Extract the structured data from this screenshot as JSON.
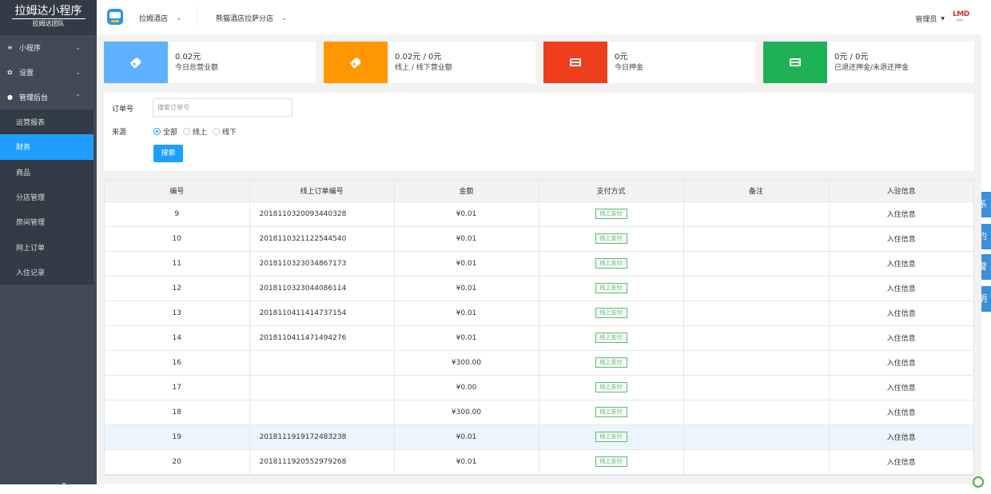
{
  "sidebar": {
    "brand_title": "拉姆达小程序",
    "brand_sub": "拉姆达团队",
    "groups": [
      {
        "icon": "menu-icon",
        "icon_glyph": "≡",
        "label": "小程序",
        "chevron": "⌄"
      },
      {
        "icon": "gear-icon",
        "icon_glyph": "✿",
        "label": "设置",
        "chevron": "⌄"
      },
      {
        "icon": "dashboard-icon",
        "icon_glyph": "●",
        "label": "管理后台",
        "chevron": "⌃"
      }
    ],
    "subitems": [
      {
        "label": "运营报表",
        "active": false
      },
      {
        "label": "财务",
        "active": true
      },
      {
        "label": "商品",
        "active": false
      },
      {
        "label": "分店管理",
        "active": false
      },
      {
        "label": "房间管理",
        "active": false
      },
      {
        "label": "网上订单",
        "active": false
      },
      {
        "label": "入住记录",
        "active": false
      }
    ]
  },
  "header": {
    "hotel_select": "拉姆酒店",
    "branch_select": "熊猫酒店拉萨分店",
    "chevron": "⌄",
    "user": "管理员",
    "user_caret": "▼",
    "logo_text": "LMD",
    "logo_sub": "拉姆达"
  },
  "stats": [
    {
      "value": "0.02元",
      "label": "今日总营业额",
      "color": "#5fb1ff",
      "icon": "tag-icon"
    },
    {
      "value": "0.02元 / 0元",
      "label": "线上 / 线下营业额",
      "color": "#ff9800",
      "icon": "tag-icon"
    },
    {
      "value": "0元",
      "label": "今日押金",
      "color": "#ee3e1c",
      "icon": "credit-card-icon"
    },
    {
      "value": "0元 / 0元",
      "label": "已退还押金/未退还押金",
      "color": "#1fb254",
      "icon": "credit-card-icon"
    }
  ],
  "search": {
    "order_label": "订单号",
    "order_placeholder": "搜索订单号",
    "source_label": "来源",
    "sources": [
      {
        "label": "全部",
        "checked": true
      },
      {
        "label": "线上",
        "checked": false
      },
      {
        "label": "线下",
        "checked": false
      }
    ],
    "button": "搜索"
  },
  "table": {
    "headers": [
      "编号",
      "线上订单编号",
      "金额",
      "支付方式",
      "备注",
      "入驻信息"
    ],
    "rows": [
      {
        "id": "9",
        "order_no": "2018110320093440328",
        "amount": "¥0.01",
        "payment": "线上支付",
        "note": "",
        "info": "入住信息",
        "highlight": false
      },
      {
        "id": "10",
        "order_no": "2018110321122544540",
        "amount": "¥0.01",
        "payment": "线上支付",
        "note": "",
        "info": "入住信息",
        "highlight": false
      },
      {
        "id": "11",
        "order_no": "2018110323034867173",
        "amount": "¥0.01",
        "payment": "线上支付",
        "note": "",
        "info": "入住信息",
        "highlight": false
      },
      {
        "id": "12",
        "order_no": "2018110323044086114",
        "amount": "¥0.01",
        "payment": "线上支付",
        "note": "",
        "info": "入住信息",
        "highlight": false
      },
      {
        "id": "13",
        "order_no": "2018110411414737154",
        "amount": "¥0.01",
        "payment": "线上支付",
        "note": "",
        "info": "入住信息",
        "highlight": false
      },
      {
        "id": "14",
        "order_no": "2018110411471494276",
        "amount": "¥0.01",
        "payment": "线上支付",
        "note": "",
        "info": "入住信息",
        "highlight": false
      },
      {
        "id": "16",
        "order_no": "",
        "amount": "¥300.00",
        "payment": "线上支付",
        "note": "",
        "info": "入住信息",
        "highlight": false
      },
      {
        "id": "17",
        "order_no": "",
        "amount": "¥0.00",
        "payment": "线上支付",
        "note": "",
        "info": "入住信息",
        "highlight": false
      },
      {
        "id": "18",
        "order_no": "",
        "amount": "¥300.00",
        "payment": "线上支付",
        "note": "",
        "info": "入住信息",
        "highlight": false
      },
      {
        "id": "19",
        "order_no": "2018111919172483238",
        "amount": "¥0.01",
        "payment": "线上支付",
        "note": "",
        "info": "入住信息",
        "highlight": true
      },
      {
        "id": "20",
        "order_no": "2018111920552979268",
        "amount": "¥0.01",
        "payment": "线上支付",
        "note": "",
        "info": "入住信息",
        "highlight": false
      }
    ]
  },
  "side_tabs": [
    "系",
    "约",
    "警",
    "明"
  ]
}
